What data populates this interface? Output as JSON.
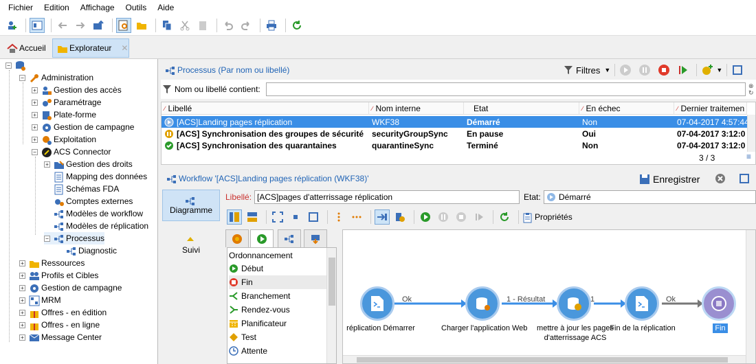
{
  "menu": [
    "Fichier",
    "Edition",
    "Affichage",
    "Outils",
    "Aide"
  ],
  "tabs": {
    "home": "Accueil",
    "explorer": "Explorateur"
  },
  "tree": {
    "root": "",
    "admin": "Administration",
    "items_admin": [
      "Gestion des accès",
      "Paramétrage",
      "Plate-forme",
      "Gestion de campagne",
      "Exploitation",
      "ACS Connector"
    ],
    "items_acs": [
      "Gestion des droits",
      "Mapping des données",
      "Schémas FDA",
      "Comptes externes",
      "Modèles de workflow",
      "Modèles de réplication",
      "Processus"
    ],
    "diag": "Diagnostic",
    "items_root": [
      "Ressources",
      "Profils et Cibles",
      "Gestion de campagne",
      "MRM",
      "Offres - en édition",
      "Offres - en ligne",
      "Message Center"
    ]
  },
  "process": {
    "title": "Processus (Par nom ou libellé)",
    "filters": "Filtres",
    "filter_label": "Nom ou libellé contient:",
    "filter_value": "",
    "columns": [
      "Libellé",
      "Nom interne",
      "Etat",
      "En échec",
      "Dernier traitemen"
    ],
    "rows": [
      {
        "label": "[ACS]Landing pages réplication",
        "name": "WKF38",
        "state": "Démarré",
        "fail": "Non",
        "last": "07-04-2017 4:57:44"
      },
      {
        "label": "[ACS] Synchronisation des groupes de sécurité",
        "name": "securityGroupSync",
        "state": "En pause",
        "fail": "Oui",
        "last": "07-04-2017 3:12:0"
      },
      {
        "label": "[ACS] Synchronisation des quarantaines",
        "name": "quarantineSync",
        "state": "Terminé",
        "fail": "Non",
        "last": "07-04-2017 3:12:0"
      }
    ],
    "count": "3 / 3"
  },
  "workflow": {
    "title": "Workflow '[ACS]Landing pages réplication (WKF38)'",
    "save": "Enregistrer",
    "label_caption": "Libellé:",
    "label_value": "[ACS]pages d'atterrissage réplication",
    "state_caption": "Etat:",
    "state_value": "Démarré",
    "side": [
      "Diagramme",
      "Suivi"
    ],
    "properties": "Propriétés"
  },
  "palette": {
    "header": "Ordonnancement",
    "items": [
      "Début",
      "Fin",
      "Branchement",
      "Rendez-vous",
      "Planificateur",
      "Test",
      "Attente"
    ]
  },
  "diagram": {
    "nodes": [
      "réplication Démarrer",
      "Charger l'application Web",
      "mettre à jour les pages\nd'atterrissage ACS",
      "Fin de la réplication",
      "Fin"
    ],
    "edges": [
      "Ok",
      "1 - Résultat",
      "1",
      "Ok"
    ]
  },
  "colors": {
    "accent": "#3a8ee6",
    "link": "#1f63b5",
    "node": "#4a97dc",
    "end": "#8e7fc9"
  }
}
